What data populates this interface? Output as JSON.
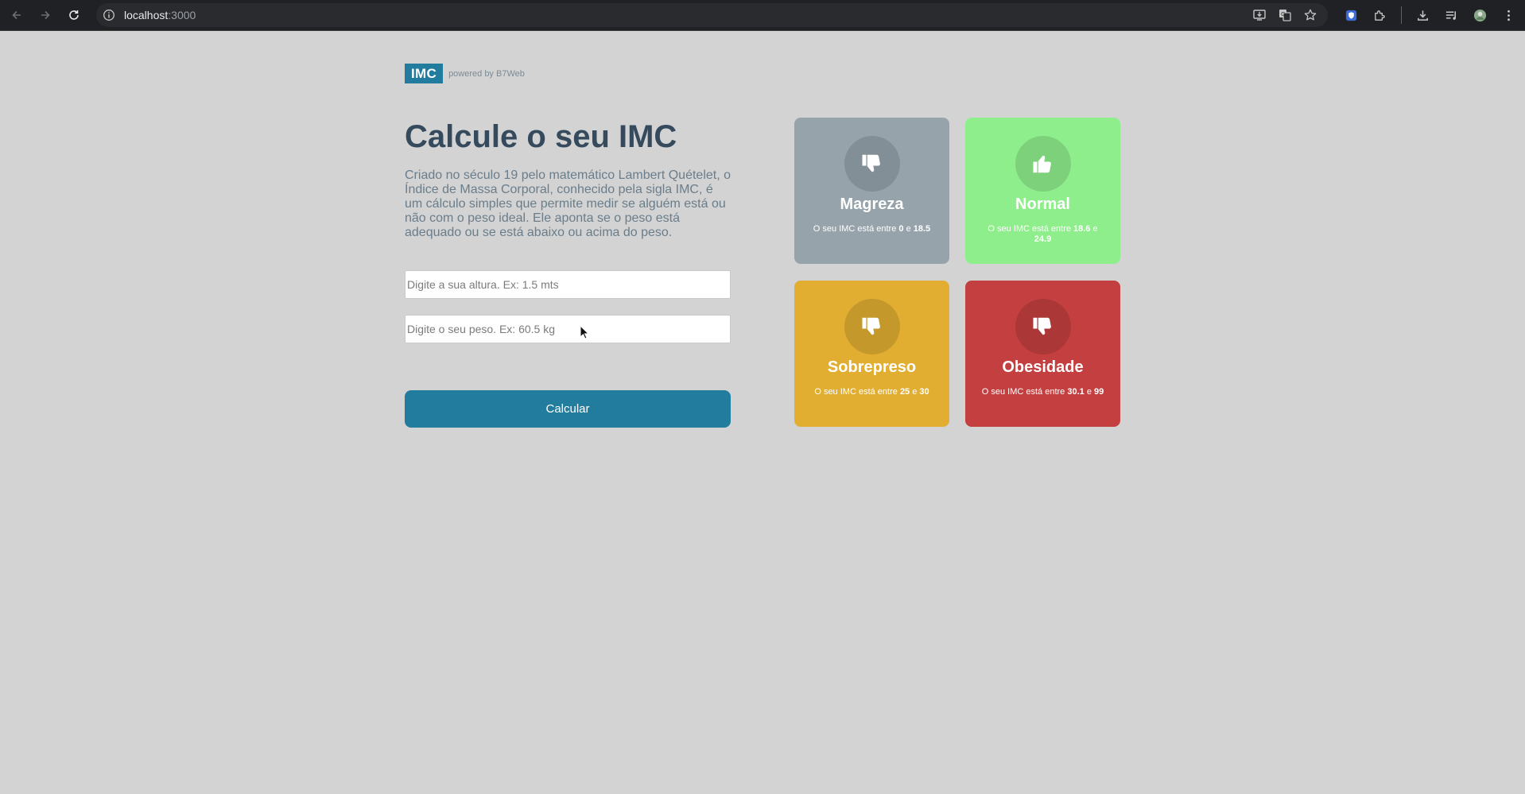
{
  "browser": {
    "url_host": "localhost",
    "url_port": ":3000"
  },
  "logo": {
    "badge": "IMC",
    "powered_by": "powered by B7Web"
  },
  "main": {
    "title": "Calcule o seu IMC",
    "description": "Criado no século 19 pelo matemático Lambert Quételet, o Índice de Massa Corporal, conhecido pela sigla IMC, é um cálculo simples que permite medir se alguém está ou não com o peso ideal. Ele aponta se o peso está adequado ou se está abaixo ou acima do peso.",
    "height_placeholder": "Digite a sua altura. Ex: 1.5 mts",
    "weight_placeholder": "Digite o seu peso. Ex: 60.5 kg",
    "calc_button": "Calcular"
  },
  "cards": [
    {
      "title": "Magreza",
      "prefix": "O seu IMC está entre ",
      "min": "0",
      "joiner": " e ",
      "max": "18.5",
      "icon": "thumbs-down-icon",
      "color": "#96a3ab"
    },
    {
      "title": "Normal",
      "prefix": "O seu IMC está entre ",
      "min": "18.6",
      "joiner": " e ",
      "max": "24.9",
      "icon": "thumbs-up-icon",
      "color": "#8fee8c"
    },
    {
      "title": "Sobrepreso",
      "prefix": "O seu IMC está entre ",
      "min": "25",
      "joiner": " e ",
      "max": "30",
      "icon": "thumbs-down-icon",
      "color": "#e1ae32"
    },
    {
      "title": "Obesidade",
      "prefix": "O seu IMC está entre ",
      "min": "30.1",
      "joiner": " e ",
      "max": "99",
      "icon": "thumbs-down-icon",
      "color": "#c43f3f"
    }
  ],
  "colors": {
    "background": "#d3d3d3",
    "accent": "#227c9d",
    "title": "#364a5d"
  }
}
